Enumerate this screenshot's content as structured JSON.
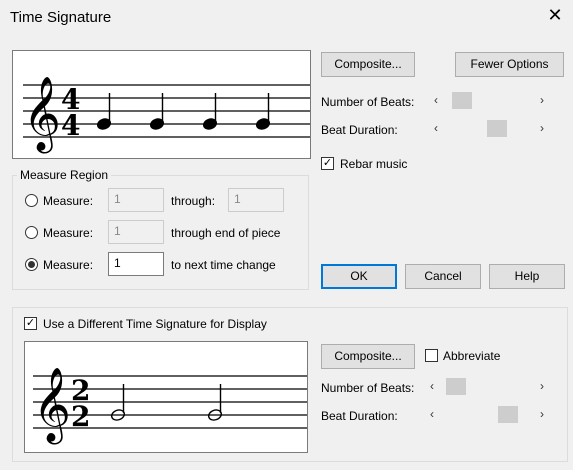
{
  "window": {
    "title": "Time Signature"
  },
  "top_panel": {
    "time_signature": {
      "numerator": "4",
      "denominator": "4"
    },
    "composite_label": "Composite...",
    "fewer_options_label": "Fewer Options",
    "number_of_beats_label": "Number of Beats:",
    "beat_duration_label": "Beat Duration:",
    "rebar_music_label": "Rebar music",
    "rebar_music_checked": true
  },
  "measure_region": {
    "title": "Measure Region",
    "option1": {
      "label": "Measure:",
      "value": "1",
      "through_label": "through:",
      "through_value": "1",
      "selected": false
    },
    "option2": {
      "label": "Measure:",
      "value": "1",
      "suffix": "through end of piece",
      "selected": false
    },
    "option3": {
      "label": "Measure:",
      "value": "1",
      "suffix": "to next time change",
      "selected": true
    }
  },
  "actions": {
    "ok": "OK",
    "cancel": "Cancel",
    "help": "Help"
  },
  "display": {
    "use_different_label": "Use a Different Time Signature for Display",
    "use_different_checked": true,
    "time_signature": {
      "numerator": "2",
      "denominator": "2"
    },
    "composite_label": "Composite...",
    "abbreviate_label": "Abbreviate",
    "abbreviate_checked": false,
    "number_of_beats_label": "Number of Beats:",
    "beat_duration_label": "Beat Duration:"
  }
}
